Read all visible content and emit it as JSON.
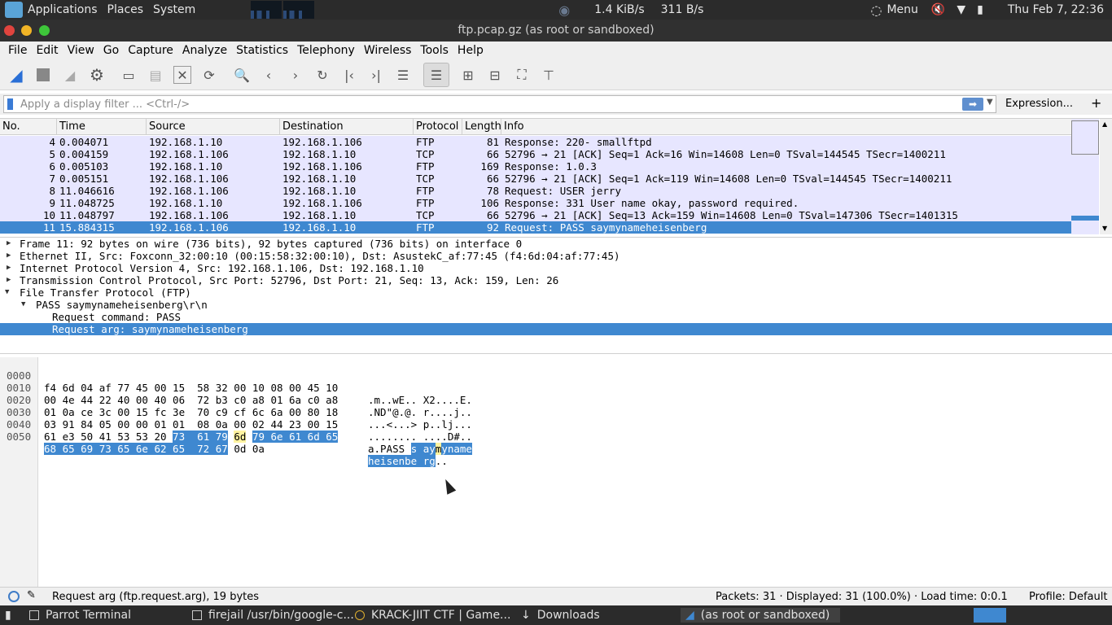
{
  "top_panel": {
    "applications": "Applications",
    "places": "Places",
    "system": "System",
    "net_down": "1.4 KiB/s",
    "net_up": "311 B/s",
    "menu": "Menu",
    "clock": "Thu Feb  7, 22:36"
  },
  "window": {
    "title": "ftp.pcap.gz (as root or sandboxed)"
  },
  "menubar": [
    "File",
    "Edit",
    "View",
    "Go",
    "Capture",
    "Analyze",
    "Statistics",
    "Telephony",
    "Wireless",
    "Tools",
    "Help"
  ],
  "filter": {
    "placeholder": "Apply a display filter ... <Ctrl-/>",
    "expression_label": "Expression...",
    "plus_label": "+"
  },
  "packet_list": {
    "columns": [
      "No.",
      "Time",
      "Source",
      "Destination",
      "Protocol",
      "Length",
      "Info"
    ],
    "rows": [
      {
        "no": "4",
        "time": "0.004071",
        "src": "192.168.1.10",
        "dst": "192.168.1.106",
        "proto": "FTP",
        "len": "81",
        "info": "Response: 220- smallftpd"
      },
      {
        "no": "5",
        "time": "0.004159",
        "src": "192.168.1.106",
        "dst": "192.168.1.10",
        "proto": "TCP",
        "len": "66",
        "info": "52796 → 21 [ACK] Seq=1 Ack=16 Win=14608 Len=0 TSval=144545 TSecr=1400211"
      },
      {
        "no": "6",
        "time": "0.005103",
        "src": "192.168.1.10",
        "dst": "192.168.1.106",
        "proto": "FTP",
        "len": "169",
        "info": "Response: 1.0.3"
      },
      {
        "no": "7",
        "time": "0.005151",
        "src": "192.168.1.106",
        "dst": "192.168.1.10",
        "proto": "TCP",
        "len": "66",
        "info": "52796 → 21 [ACK] Seq=1 Ack=119 Win=14608 Len=0 TSval=144545 TSecr=1400211"
      },
      {
        "no": "8",
        "time": "11.046616",
        "src": "192.168.1.106",
        "dst": "192.168.1.10",
        "proto": "FTP",
        "len": "78",
        "info": "Request: USER jerry"
      },
      {
        "no": "9",
        "time": "11.048725",
        "src": "192.168.1.10",
        "dst": "192.168.1.106",
        "proto": "FTP",
        "len": "106",
        "info": "Response: 331 User name okay, password required."
      },
      {
        "no": "10",
        "time": "11.048797",
        "src": "192.168.1.106",
        "dst": "192.168.1.10",
        "proto": "TCP",
        "len": "66",
        "info": "52796 → 21 [ACK] Seq=13 Ack=159 Win=14608 Len=0 TSval=147306 TSecr=1401315"
      },
      {
        "no": "11",
        "time": "15.884315",
        "src": "192.168.1.106",
        "dst": "192.168.1.10",
        "proto": "FTP",
        "len": "92",
        "info": "Request: PASS saymynameheisenberg"
      }
    ]
  },
  "details": [
    "Frame 11: 92 bytes on wire (736 bits), 92 bytes captured (736 bits) on interface 0",
    "Ethernet II, Src: Foxconn_32:00:10 (00:15:58:32:00:10), Dst: AsustekC_af:77:45 (f4:6d:04:af:77:45)",
    "Internet Protocol Version 4, Src: 192.168.1.106, Dst: 192.168.1.10",
    "Transmission Control Protocol, Src Port: 52796, Dst Port: 21, Seq: 13, Ack: 159, Len: 26",
    "File Transfer Protocol (FTP)",
    "PASS saymynameheisenberg\\r\\n",
    "Request command: PASS",
    "Request arg: saymynameheisenberg"
  ],
  "bytes": {
    "offsets": [
      "0000",
      "0010",
      "0020",
      "0030",
      "0040",
      "0050"
    ],
    "hex": [
      "f4 6d 04 af 77 45 00 15  58 32 00 10 08 00 45 10",
      "00 4e 44 22 40 00 40 06  72 b3 c0 a8 01 6a c0 a8",
      "01 0a ce 3c 00 15 fc 3e  70 c9 cf 6c 6a 00 80 18",
      "03 91 84 05 00 00 01 01  08 0a 00 02 44 23 00 15"
    ],
    "ascii": [
      ".m..wE.. X2....E.",
      ".ND\"@.@. r....j..",
      "...<...> p..lj...",
      "........ ....D#.."
    ],
    "row4_plain_hex": "61 e3 50 41 53 53 20",
    "row4_hl_hex_a": "73",
    "row4_hl_hex_b": "61 79",
    "row4_yl_hex": "6d",
    "row4_hl_hex_c": "79 6e 61 6d 65",
    "row4_plain_ascii": "a.PASS ",
    "row4_hl_ascii_a": "s ay",
    "row4_yl_ascii": "m",
    "row4_hl_ascii_b": "yname",
    "row5_hl_hex": "68 65 69 73 65 6e 62 65  72 67",
    "row5_plain_hex": "0d 0a",
    "row5_hl_ascii": "heisenbe rg",
    "row5_plain_ascii": ".."
  },
  "statusbar": {
    "field": "Request arg (ftp.request.arg), 19 bytes",
    "packets": "Packets: 31 · Displayed: 31 (100.0%) · Load time: 0:0.1",
    "profile": "Profile: Default"
  },
  "taskbar": [
    "Parrot Terminal",
    "firejail /usr/bin/google-c...",
    "KRACK-JIIT CTF | Game...",
    "Downloads",
    "(as root or sandboxed)"
  ],
  "colors": {
    "selection": "#3f88d0",
    "ftp_row": "#e7e6ff",
    "panel": "#2b2b2b"
  }
}
